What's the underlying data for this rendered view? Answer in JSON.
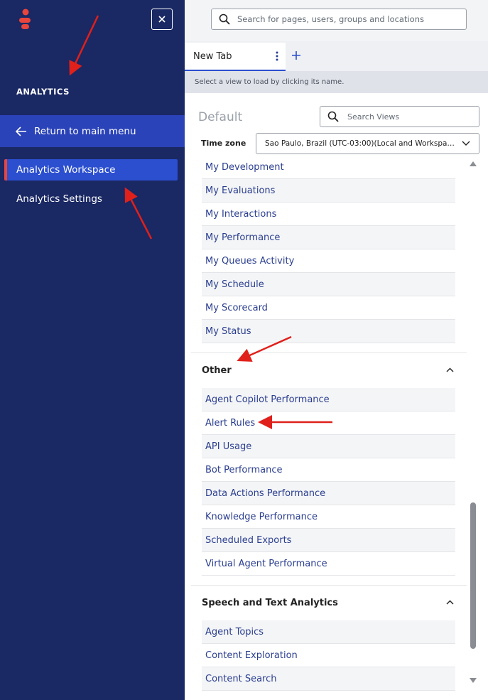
{
  "sidebar": {
    "section_title": "ANALYTICS",
    "return_label": "Return to main menu",
    "items": [
      {
        "label": "Analytics Workspace",
        "active": true
      },
      {
        "label": "Analytics Settings",
        "active": false
      }
    ],
    "brand_color": "#e8453c",
    "bg_color": "#1a2864"
  },
  "topbar": {
    "search_placeholder": "Search for pages, users, groups and locations"
  },
  "tabs": [
    {
      "label": "New Tab"
    }
  ],
  "hint": "Select a view to load by clicking its name.",
  "views": {
    "title": "Default",
    "search_placeholder": "Search Views",
    "timezone_label": "Time zone",
    "timezone_value": "Sao Paulo, Brazil (UTC-03:00)(Local and Workspace)"
  },
  "groups": [
    {
      "name": "",
      "items": [
        "My Development",
        "My Evaluations",
        "My Interactions",
        "My Performance",
        "My Queues Activity",
        "My Schedule",
        "My Scorecard",
        "My Status"
      ]
    },
    {
      "name": "Other",
      "items": [
        "Agent Copilot Performance",
        "Alert Rules",
        "API Usage",
        "Bot Performance",
        "Data Actions Performance",
        "Knowledge Performance",
        "Scheduled Exports",
        "Virtual Agent Performance"
      ]
    },
    {
      "name": "Speech and Text Analytics",
      "items": [
        "Agent Topics",
        "Content Exploration",
        "Content Search"
      ]
    }
  ]
}
